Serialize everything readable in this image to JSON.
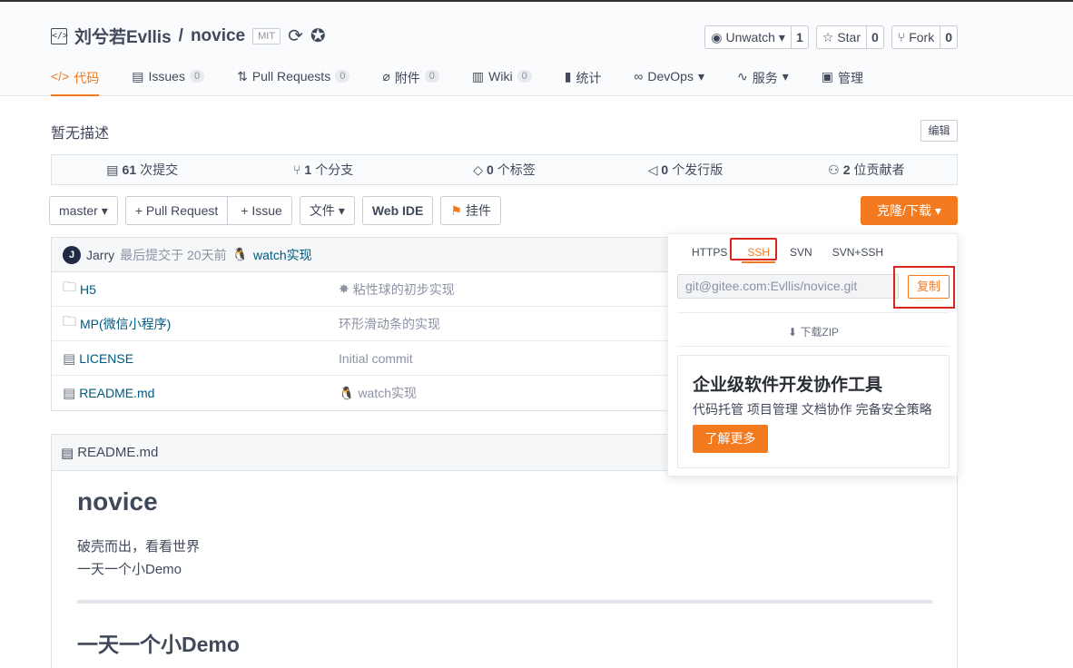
{
  "repo": {
    "owner": "刘兮若Evllis",
    "separator": "/",
    "name": "novice",
    "license": "MIT",
    "description": "暂无描述",
    "edit_label": "编辑"
  },
  "actions": {
    "watch_label": "Unwatch",
    "watch_count": "1",
    "star_label": "Star",
    "star_count": "0",
    "fork_label": "Fork",
    "fork_count": "0"
  },
  "tabs": [
    {
      "label": "代码",
      "icon": "code-icon",
      "badge": ""
    },
    {
      "label": "Issues",
      "icon": "issues-icon",
      "badge": "0"
    },
    {
      "label": "Pull Requests",
      "icon": "pull-request-icon",
      "badge": "0"
    },
    {
      "label": "附件",
      "icon": "attachment-icon",
      "badge": "0"
    },
    {
      "label": "Wiki",
      "icon": "wiki-icon",
      "badge": "0"
    },
    {
      "label": "统计",
      "icon": "stats-icon",
      "badge": ""
    },
    {
      "label": "DevOps",
      "icon": "devops-icon",
      "badge": ""
    },
    {
      "label": "服务",
      "icon": "service-icon",
      "badge": ""
    },
    {
      "label": "管理",
      "icon": "manage-icon",
      "badge": ""
    }
  ],
  "stats": [
    {
      "num": "61",
      "text": "次提交"
    },
    {
      "num": "1",
      "text": "个分支"
    },
    {
      "num": "0",
      "text": "个标签"
    },
    {
      "num": "0",
      "text": "个发行版"
    },
    {
      "num": "2",
      "text": "位贡献者"
    }
  ],
  "toolbar": {
    "branch": "master",
    "pull_request": "+ Pull Request",
    "issue": "+ Issue",
    "files": "文件",
    "web_ide": "Web IDE",
    "widget": "挂件",
    "clone": "克隆/下载"
  },
  "commit": {
    "avatar": "J",
    "author": "Jarry",
    "time": "最后提交于 20天前",
    "message": "watch实现"
  },
  "files": [
    {
      "name": "H5",
      "type": "folder",
      "message": "粘性球的初步实现"
    },
    {
      "name": "MP(微信小程序)",
      "type": "folder",
      "message": "环形滑动条的实现"
    },
    {
      "name": "LICENSE",
      "type": "file",
      "message": "Initial commit"
    },
    {
      "name": "README.md",
      "type": "file",
      "message": "watch实现"
    }
  ],
  "readme": {
    "filename": "README.md",
    "title": "novice",
    "line1": "破壳而出，看看世界",
    "line2": "一天一个小Demo",
    "heading2": "一天一个小Demo"
  },
  "clone_dropdown": {
    "protocols": [
      "HTTPS",
      "SSH",
      "SVN",
      "SVN+SSH"
    ],
    "active_protocol": "SSH",
    "url": "git@gitee.com:Evllis/novice.git",
    "copy_label": "复制",
    "download_zip": "下载ZIP",
    "promo_title": "企业级软件开发协作工具",
    "promo_subtitle": "代码托管 项目管理 文档协作 完备安全策略",
    "promo_button": "了解更多"
  },
  "colors": {
    "accent": "#f37a1f",
    "link": "#005980",
    "highlight_box": "#d9261c"
  }
}
